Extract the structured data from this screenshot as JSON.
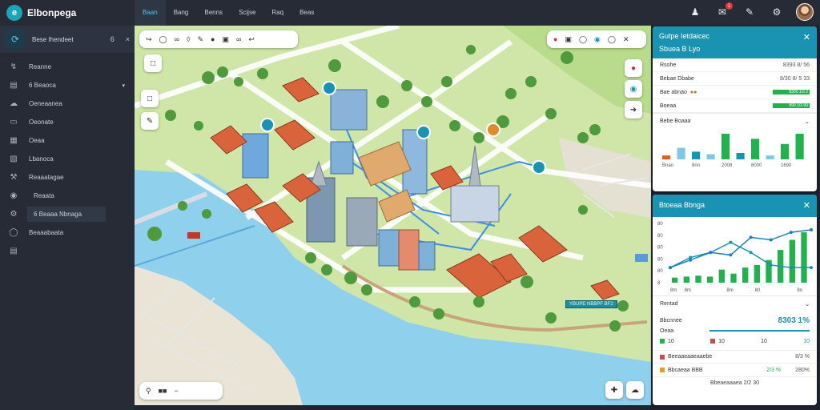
{
  "app": {
    "title": "Elbonpega"
  },
  "topnav": [
    {
      "label": "Baan",
      "active": true
    },
    {
      "label": "Bang",
      "active": false
    },
    {
      "label": "Benns",
      "active": false
    },
    {
      "label": "Scijse",
      "active": false
    },
    {
      "label": "Raq",
      "active": false
    },
    {
      "label": "Beas",
      "active": false
    }
  ],
  "top_actions": {
    "badge_count": "1"
  },
  "sidebar": {
    "header": {
      "label": "Bese Ihendeet",
      "count": "6",
      "close": "×"
    },
    "items": [
      {
        "label": "Reanne",
        "icon": "chart-icon"
      },
      {
        "label": "6 Beaoca",
        "icon": "folder-icon",
        "caret": "▾"
      },
      {
        "label": "Oeneaanea",
        "icon": "cloud-icon"
      },
      {
        "label": "Oeonate",
        "icon": "screen-icon"
      },
      {
        "label": "Oeaa",
        "icon": "table-icon"
      },
      {
        "label": "Lbanoca",
        "icon": "book-icon"
      },
      {
        "label": "Reaaatagae",
        "icon": "tools-icon"
      },
      {
        "label": "Reaata",
        "icon": "globe-icon",
        "sub": true
      },
      {
        "label": "6 Beaaa Nbnaga",
        "icon": "gear-icon",
        "active": true
      },
      {
        "label": "Beaaabaata",
        "icon": "chat-icon",
        "sub": true
      },
      {
        "label": "",
        "icon": "doc-icon"
      }
    ]
  },
  "map": {
    "tag_label": "YBUPE NBBPF BF2"
  },
  "panel1": {
    "title": "Gutpe Ietdaicec",
    "subtitle": "Sbuea B Lyo",
    "rows": [
      {
        "label": "Rsohe",
        "value": "8393 8/ 56"
      },
      {
        "label": "Bebae Dbabe",
        "value": "8/30 8/ 5 33"
      },
      {
        "label": "Bae abnao",
        "value": "8300 1/3 2"
      },
      {
        "label": "Boeaa",
        "value": "890 1/3 90"
      }
    ],
    "section": "Bebe Boaaa",
    "chart_data": {
      "type": "bar",
      "categories": [
        "",
        "",
        "",
        "",
        "",
        "",
        "",
        "",
        "",
        ""
      ],
      "series": [
        {
          "values": [
            0.15,
            0.45,
            0.3,
            0.2,
            1.0,
            0.25,
            0.8,
            0.15,
            0.6,
            1.0
          ],
          "colors": [
            "#e05a2a",
            "#7ec8e3",
            "#1a93b3",
            "#7ec8e3",
            "#22b14c",
            "#1a93b3",
            "#22b14c",
            "#7ec8e3",
            "#22b14c",
            "#22b14c"
          ]
        }
      ],
      "tick_labels": [
        "Bnao",
        "",
        "8nn",
        "",
        "2008",
        "",
        "8000",
        "",
        "1690",
        ""
      ]
    }
  },
  "panel2": {
    "title": "Btoeaa Bbnga",
    "chart_data": {
      "type": "bar+line",
      "y_ticks": [
        "8",
        "80",
        "80",
        "80",
        "80",
        "80"
      ],
      "categories": [
        "8m",
        "8m",
        "",
        "",
        "8m",
        "",
        "80",
        "",
        "",
        "8n"
      ],
      "bars": [
        0.1,
        0.12,
        0.14,
        0.12,
        0.26,
        0.18,
        0.3,
        0.35,
        0.45,
        0.65,
        0.85,
        1.0
      ],
      "line1": [
        0.3,
        0.45,
        0.6,
        0.55,
        0.9,
        0.85,
        1.0,
        1.05
      ],
      "line2": [
        0.3,
        0.5,
        0.6,
        0.8,
        0.6,
        0.35,
        0.3,
        0.3
      ]
    },
    "section": "Rentad",
    "summary": {
      "label": "Bbcnnee",
      "value": "8303 1%",
      "sub_label": "Oeaa",
      "legend": [
        "10",
        "10",
        "10",
        "10"
      ]
    },
    "rows": [
      {
        "label": "Beeaaeaaeaaebe",
        "value": "8/3 %",
        "color": "#c0504d"
      },
      {
        "label": "Bbcaeaa BBB",
        "mid": "2/3 %",
        "value": "280%",
        "color": "#e0a020"
      }
    ],
    "footer": "Bbeaeaaaea 2/2 30"
  }
}
